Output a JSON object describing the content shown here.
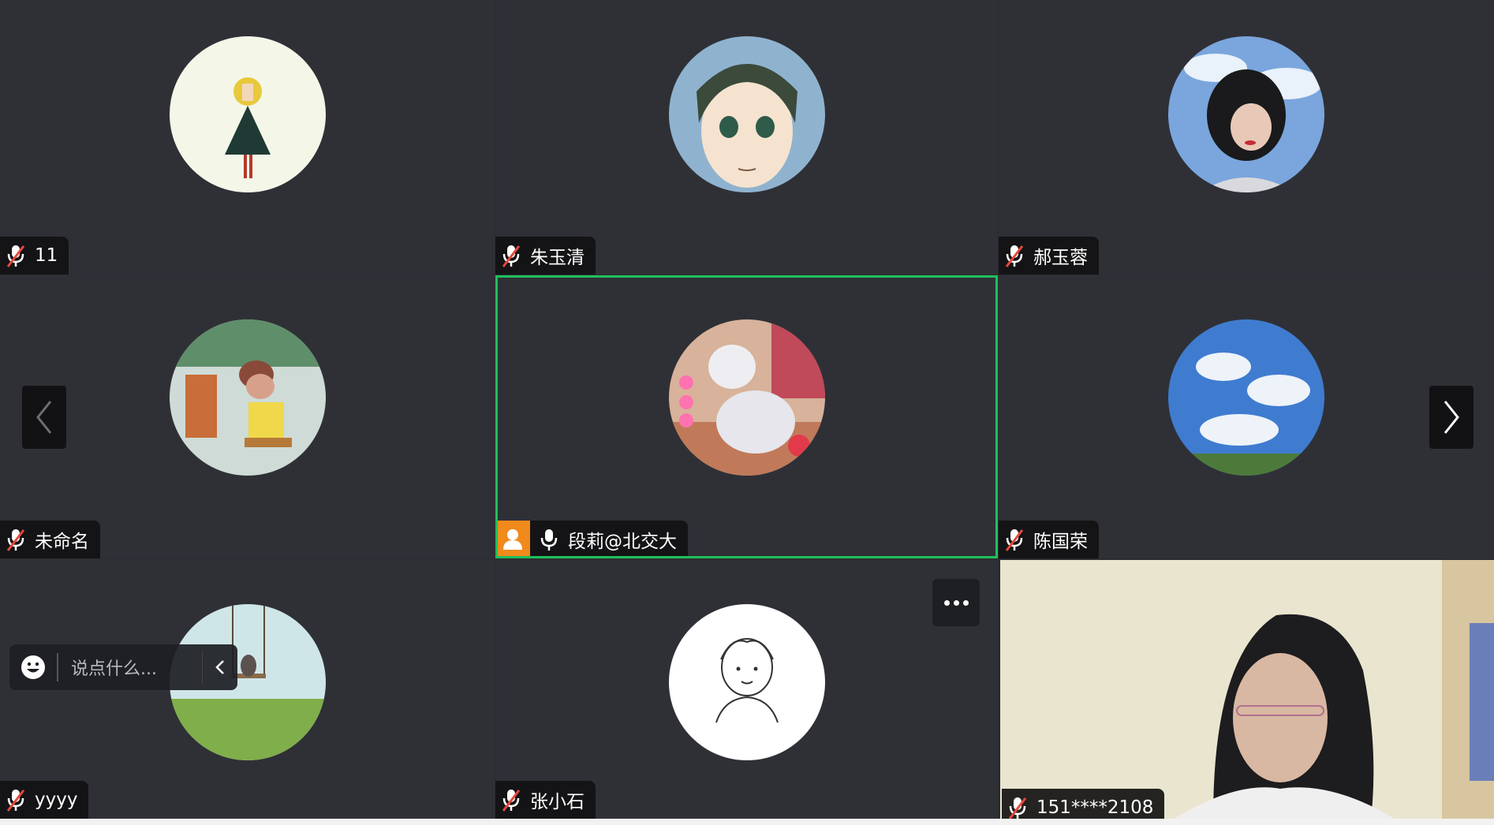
{
  "participants": [
    {
      "name": "11",
      "muted": true
    },
    {
      "name": "朱玉清",
      "muted": true
    },
    {
      "name": "郝玉蓉",
      "muted": true
    },
    {
      "name": "未命名",
      "muted": true
    },
    {
      "name": "段莉@北交大",
      "muted": false,
      "host": true,
      "active_speaker": true
    },
    {
      "name": "陈国荣",
      "muted": true
    },
    {
      "name": "yyyy",
      "muted": true
    },
    {
      "name": "张小石",
      "muted": true
    },
    {
      "name": "151****2108",
      "muted": true,
      "video_on": true
    }
  ],
  "chat": {
    "placeholder": "说点什么..."
  },
  "controls": {
    "prev_icon": "chevron-left-icon",
    "next_icon": "chevron-right-icon",
    "more_icon": "more-dots-icon"
  },
  "colors": {
    "active_border": "#1fbf5b",
    "host_badge": "#f08a1c",
    "muted_red": "#e5483b",
    "tile_bg": "#2f3036"
  }
}
